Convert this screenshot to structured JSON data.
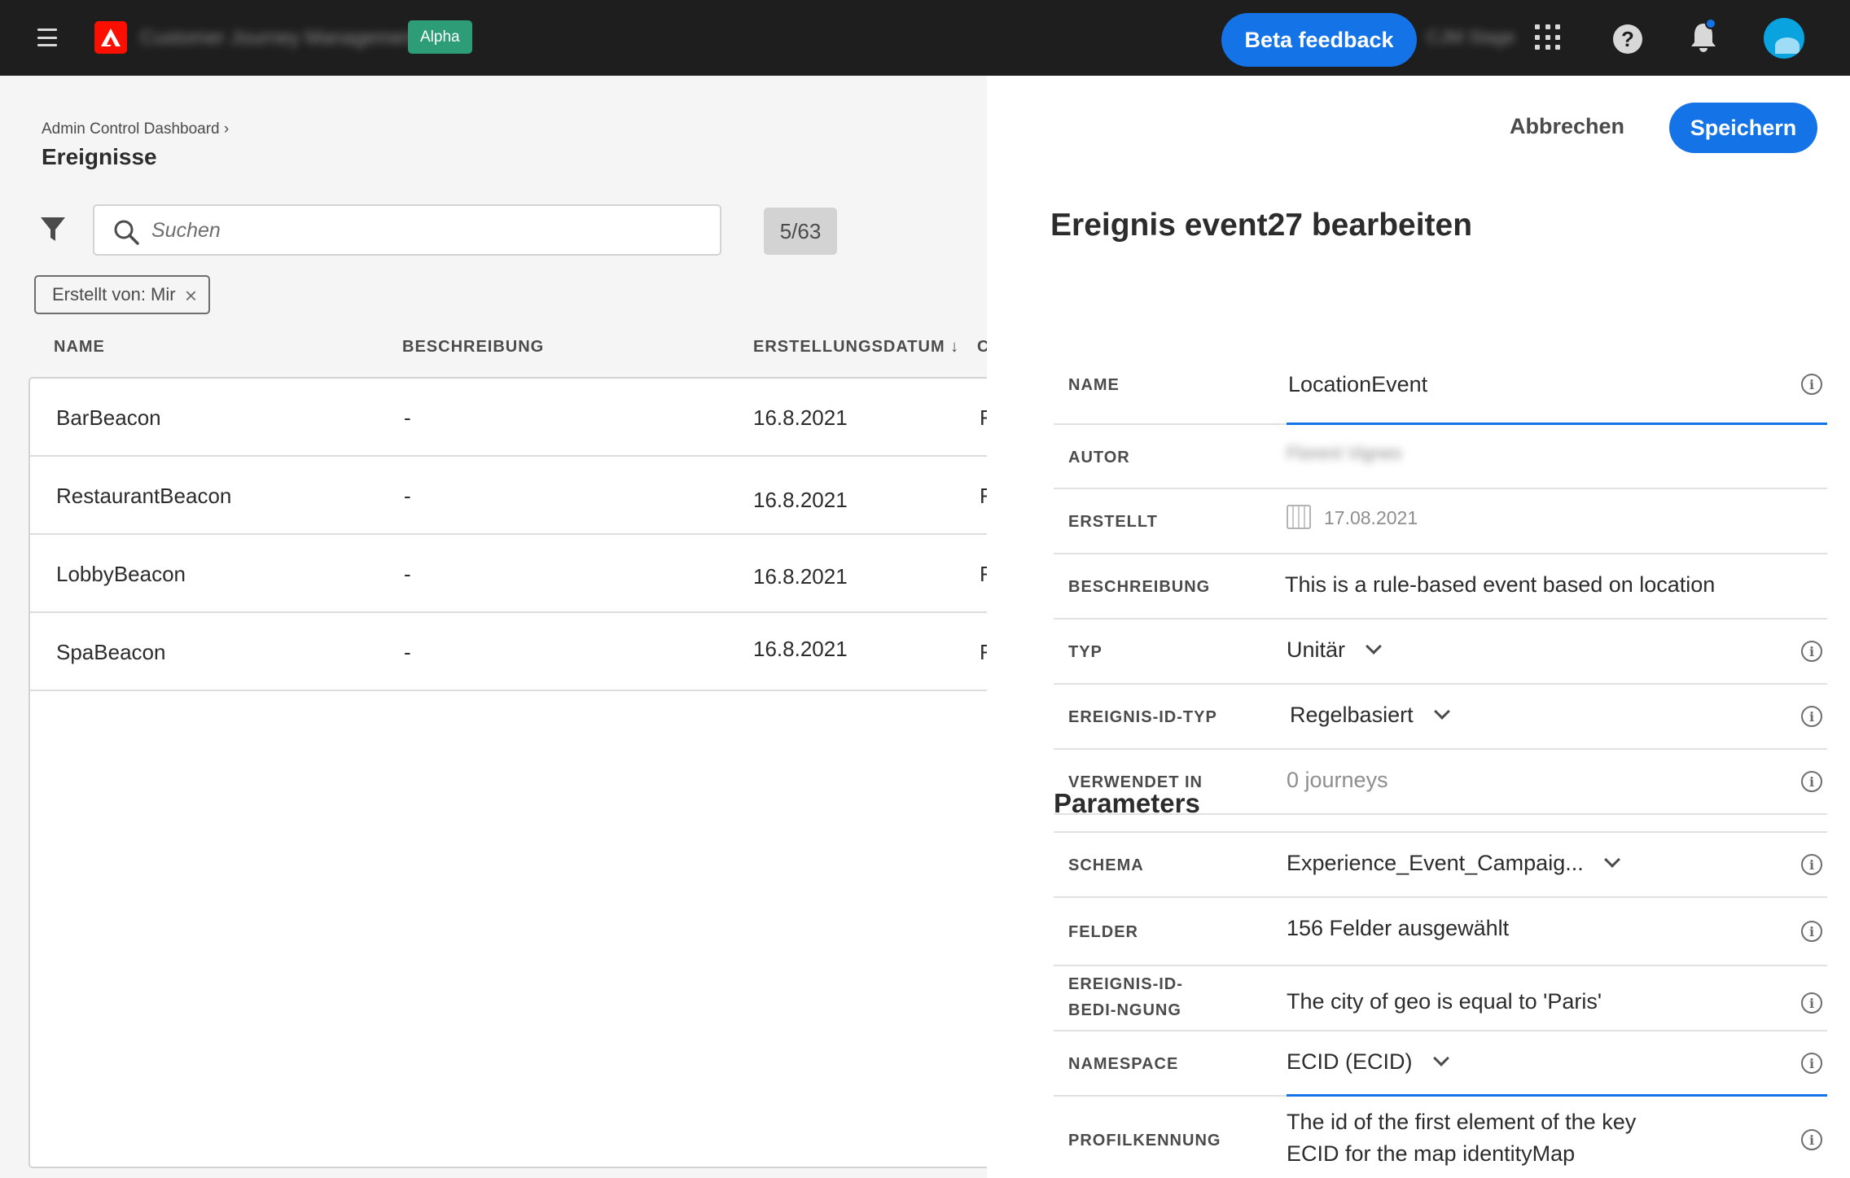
{
  "topbar": {
    "app_name": "Customer Journey Management",
    "badge": "Alpha",
    "beta_feedback": "Beta feedback",
    "org_name": "CJM Stage",
    "help_glyph": "?"
  },
  "list": {
    "breadcrumb": "Admin Control Dashboard ›",
    "title": "Ereignisse",
    "search_placeholder": "Suchen",
    "count": "5/63",
    "filter_tag": "Erstellt von: Mir",
    "filter_tag_close": "×",
    "columns": {
      "name": "NAME",
      "description": "BESCHREIBUNG",
      "created": "ERSTELLUNGSDATUM ↓",
      "next_partial": "C"
    },
    "rows": [
      {
        "name": "BarBeacon",
        "description": "-",
        "date": "16.8.2021",
        "extra": "F"
      },
      {
        "name": "RestaurantBeacon",
        "description": "-",
        "date": "16.8.2021",
        "extra": "F"
      },
      {
        "name": "LobbyBeacon",
        "description": "-",
        "date": "16.8.2021",
        "extra": "F"
      },
      {
        "name": "SpaBeacon",
        "description": "-",
        "date": "16.8.2021",
        "extra": "F"
      }
    ]
  },
  "edit": {
    "cancel": "Abbrechen",
    "save": "Speichern",
    "title": "Ereignis event27 bearbeiten",
    "fields": {
      "name": {
        "label": "NAME",
        "value": "LocationEvent"
      },
      "author": {
        "label": "AUTOR",
        "value": "Florent Vignes"
      },
      "created": {
        "label": "ERSTELLT",
        "value": "17.08.2021"
      },
      "description": {
        "label": "BESCHREIBUNG",
        "value": "This is a rule-based event based on location"
      },
      "type": {
        "label": "TYP",
        "value": "Unitär"
      },
      "id_type": {
        "label": "EREIGNIS-ID-TYP",
        "value": "Regelbasiert"
      },
      "used_in": {
        "label": "VERWENDET IN",
        "value": "0 journeys"
      }
    },
    "parameters_title": "Parameters",
    "params": {
      "schema": {
        "label": "SCHEMA",
        "value": "Experience_Event_Campaig..."
      },
      "fields": {
        "label": "FELDER",
        "value": "156 Felder ausgewählt"
      },
      "id_condition": {
        "label": "EREIGNIS-ID-BEDI-NGUNG",
        "value": "The city of geo is equal to 'Paris'"
      },
      "namespace": {
        "label": "NAMESPACE",
        "value": "ECID (ECID)"
      },
      "profile_id": {
        "label": "PROFILKENNUNG",
        "value_line1": "The id of the first element of the key",
        "value_line2": "ECID for the map identityMap"
      }
    },
    "info_glyph": "i"
  },
  "colors": {
    "accent": "#1473e6",
    "topbar": "#1e1e1e",
    "alpha_badge": "#2d9d78",
    "logo": "#fa0f00"
  },
  "icons": [
    "hamburger-icon",
    "adobe-logo-icon",
    "apps-grid-icon",
    "help-icon",
    "bell-icon",
    "filter-icon",
    "search-icon",
    "close-icon",
    "info-icon",
    "chevron-down-icon",
    "calendar-icon",
    "sort-down-arrow-icon"
  ]
}
